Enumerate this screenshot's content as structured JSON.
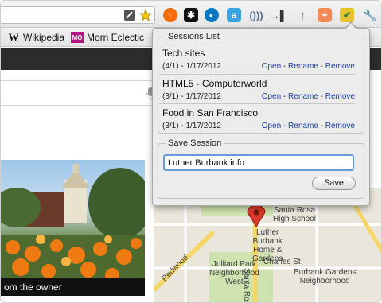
{
  "bookmarks": {
    "items": [
      {
        "label": "Wikipedia",
        "icon": "wikipedia-w-icon"
      },
      {
        "label": "Morn Eclectic",
        "icon": "morn-eclectic-icon"
      }
    ]
  },
  "extensions": [
    {
      "icon": "wrench-pencil-icon"
    },
    {
      "icon": "star-icon"
    },
    {
      "icon": "orange-ext-icon"
    },
    {
      "icon": "puzzle-dark-icon"
    },
    {
      "icon": "blue-circle-icon"
    },
    {
      "icon": "blue-square-icon"
    },
    {
      "icon": "sound-wave-icon"
    },
    {
      "icon": "dock-arrow-icon"
    },
    {
      "icon": "up-arrow-icon"
    },
    {
      "icon": "plus-orange-icon"
    },
    {
      "icon": "session-basket-icon"
    },
    {
      "icon": "wrench-icon"
    }
  ],
  "page": {
    "caption": "om the owner"
  },
  "popup": {
    "sessions_title": "Sessions List",
    "sessions": [
      {
        "name": "Tech sites",
        "date": "(4/1) - 1/17/2012",
        "open": "Open",
        "rename": "Rename",
        "remove": "Remove"
      },
      {
        "name": "HTML5 - Computerworld",
        "date": "(3/1) - 1/17/2012",
        "open": "Open",
        "rename": "Rename",
        "remove": "Remove"
      },
      {
        "name": "Food in San Francisco",
        "date": "(3/1) - 1/17/2012",
        "open": "Open",
        "rename": "Rename",
        "remove": "Remove"
      }
    ],
    "action_separator": " - ",
    "save_title": "Save Session",
    "save_input_value": "Luther Burbank info",
    "save_button": "Save"
  },
  "map": {
    "labels": {
      "santa_rosa_hs": "Santa Rosa\nHigh School",
      "luther_burbank": "Luther\nBurbank\nHome &\nGardens",
      "charles_st": "Charles St",
      "julliard_park": "Julliard Park\nNeighborhood\nWest",
      "burbank_gardens": "Burbank Gardens\nNeighborhood",
      "redwood": "Redwood",
      "santa_rosa_ave": "Santa Rosa"
    }
  }
}
